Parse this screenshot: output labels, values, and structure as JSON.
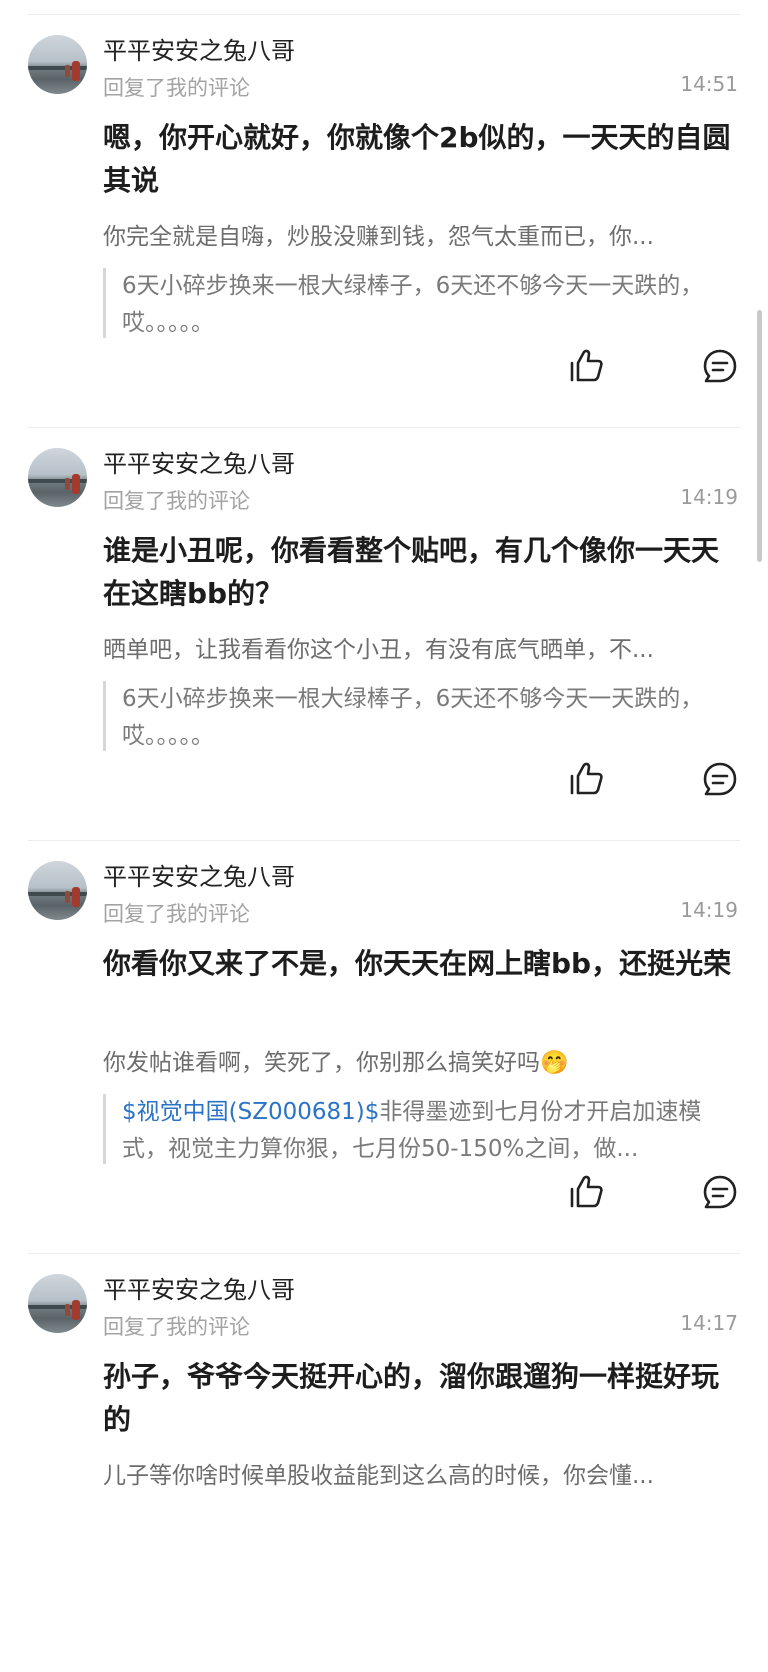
{
  "replies": [
    {
      "user": "平平安安之兔八哥",
      "action": "回复了我的评论",
      "time": "14:51",
      "text": "嗯，你开心就好，你就像个2b似的，一天天的自圆其说",
      "my_comment": "你完全就是自嗨，炒股没赚到钱，怨气太重而已，你...",
      "quote_stock": "",
      "quote_text": "6天小碎步换来一根大绿棒子，6天还不够今天一天跌的，哎。。。。。"
    },
    {
      "user": "平平安安之兔八哥",
      "action": "回复了我的评论",
      "time": "14:19",
      "text": "谁是小丑呢，你看看整个贴吧，有几个像你一天天在这瞎bb的？",
      "my_comment": "晒单吧，让我看看你这个小丑，有没有底气晒单，不...",
      "quote_stock": "",
      "quote_text": "6天小碎步换来一根大绿棒子，6天还不够今天一天跌的，哎。。。。。"
    },
    {
      "user": "平平安安之兔八哥",
      "action": "回复了我的评论",
      "time": "14:19",
      "text": "你看你又来了不是，你天天在网上瞎bb，还挺光荣",
      "my_comment": "你发帖谁看啊，笑死了，你别那么搞笑好吗🤭",
      "quote_stock": "$视觉中国(SZ000681)$",
      "quote_text": "非得墨迹到七月份才开启加速模式，视觉主力算你狠，七月份50-150%之间，做..."
    },
    {
      "user": "平平安安之兔八哥",
      "action": "回复了我的评论",
      "time": "14:17",
      "text": "孙子，爷爷今天挺开心的，溜你跟遛狗一样挺好玩的",
      "my_comment": "儿子等你啥时候单股收益能到这么高的时候，你会懂...",
      "quote_stock": "",
      "quote_text": ""
    }
  ],
  "icons": {
    "like": "thumbs-up-icon",
    "comment": "comment-bubble-icon"
  },
  "colors": {
    "stock_link": "#2a73c7",
    "muted": "#a3a3a3"
  }
}
